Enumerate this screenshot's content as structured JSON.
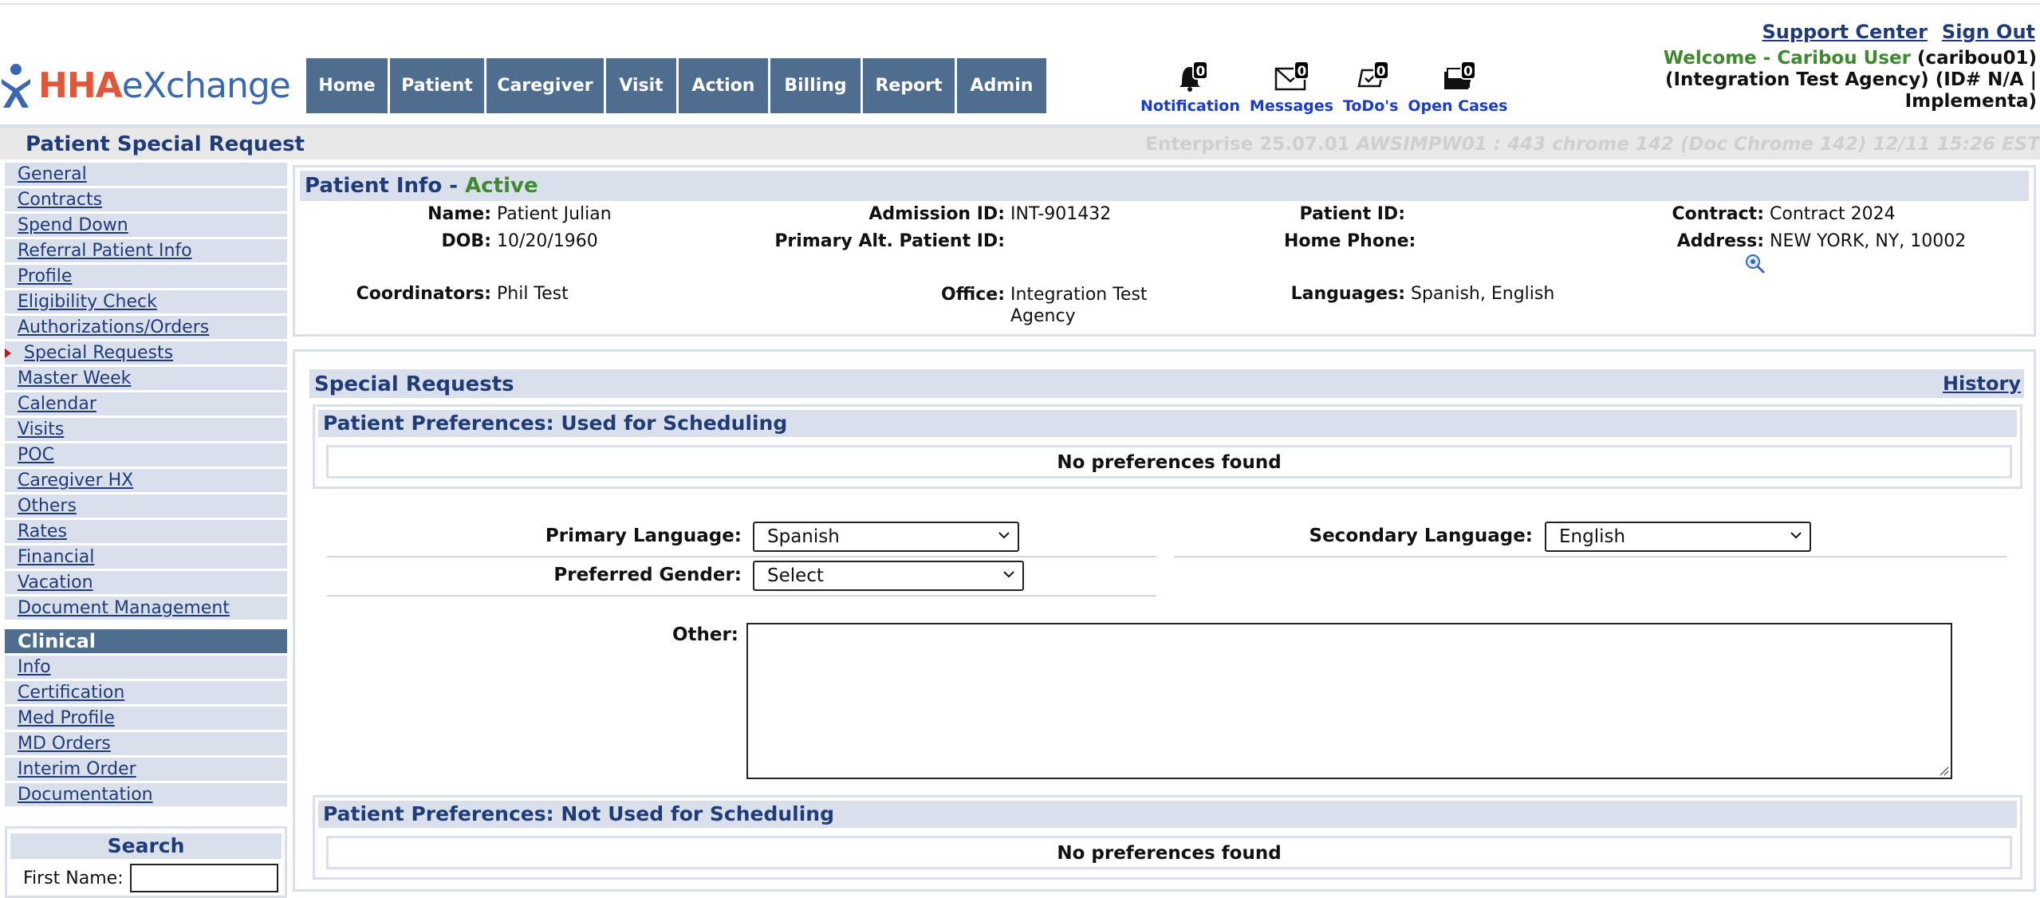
{
  "logo": {
    "part1": "HHA",
    "part2": "eXchange"
  },
  "nav": [
    "Home",
    "Patient",
    "Caregiver",
    "Visit",
    "Action",
    "Billing",
    "Report",
    "Admin"
  ],
  "tools": [
    {
      "label": "Notification",
      "count": "0",
      "icon": "bell-icon"
    },
    {
      "label": "Messages",
      "count": "0",
      "icon": "envelope-icon"
    },
    {
      "label": "ToDo's",
      "count": "0",
      "icon": "todo-icon"
    },
    {
      "label": "Open Cases",
      "count": "0",
      "icon": "folder-icon"
    }
  ],
  "header": {
    "support": "Support Center",
    "signout": "Sign Out",
    "welcome_green": "Welcome - Caribou User",
    "welcome_user": " (caribou01)",
    "welcome_line2": "(Integration Test Agency) (ID# N/A |",
    "welcome_line3": "Implementa)"
  },
  "page": {
    "title": "Patient Special Request",
    "build": "Enterprise 25.07.01",
    "build_italic": " AWSIMPW01 : 443 chrome 142 (Doc Chrome 142) 12/11 15:26 EST"
  },
  "sidebar": {
    "items": [
      "General",
      "Contracts",
      "Spend Down",
      "Referral Patient Info",
      "Profile",
      "Eligibility Check",
      "Authorizations/Orders",
      "Special Requests",
      "Master Week",
      "Calendar",
      "Visits",
      "POC",
      "Caregiver HX",
      "Others",
      "Rates",
      "Financial",
      "Vacation",
      "Document Management"
    ],
    "active_index": 7,
    "clinical_header": "Clinical",
    "clinical_items": [
      "Info",
      "Certification",
      "Med Profile",
      "MD Orders",
      "Interim Order",
      "Documentation"
    ],
    "search_title": "Search",
    "first_name_label": "First Name:"
  },
  "patient_info": {
    "heading": "Patient Info - ",
    "status": "Active",
    "name_label": "Name:",
    "name": "Patient Julian",
    "admission_label": "Admission ID:",
    "admission": "INT-901432",
    "pid_label": "Patient ID:",
    "pid": "",
    "contract_label": "Contract:",
    "contract": "Contract 2024",
    "dob_label": "DOB:",
    "dob": "10/20/1960",
    "alt_label": "Primary Alt. Patient ID:",
    "alt": "",
    "phone_label": "Home Phone:",
    "phone": "",
    "address_label": "Address:",
    "address": "NEW YORK, NY, 10002",
    "coord_label": "Coordinators:",
    "coord": "Phil Test",
    "office_label": "Office:",
    "office_line1": "Integration Test",
    "office_line2": "Agency",
    "lang_label": "Languages:",
    "lang": "Spanish, English"
  },
  "special_requests": {
    "title": "Special Requests",
    "history": "History",
    "pref_used_title": "Patient Preferences: Used for Scheduling",
    "pref_used_empty": "No preferences found",
    "primary_language_label": "Primary Language:",
    "primary_language": "Spanish",
    "secondary_language_label": "Secondary Language:",
    "secondary_language": "English",
    "preferred_gender_label": "Preferred Gender:",
    "preferred_gender": "Select",
    "other_label": "Other:",
    "pref_not_used_title": "Patient Preferences: Not Used for Scheduling",
    "pref_not_used_empty": "No preferences found"
  }
}
